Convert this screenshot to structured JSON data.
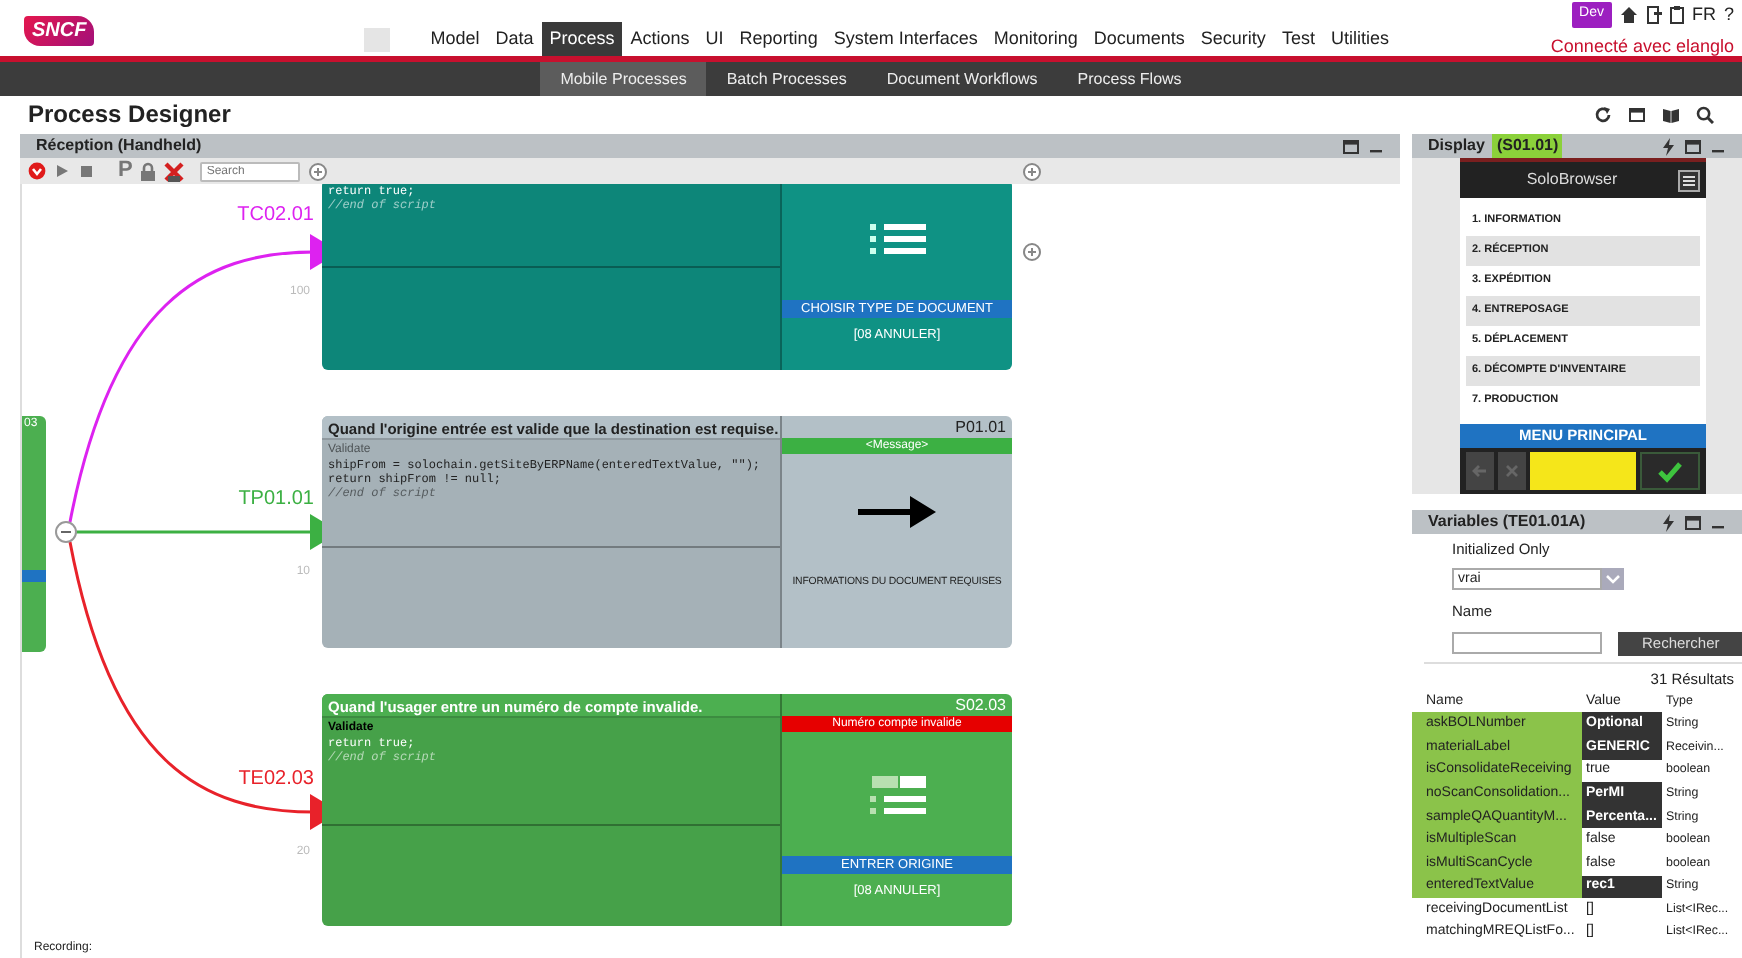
{
  "header": {
    "logo": "SNCF",
    "nav": [
      {
        "label": "Model",
        "selected": false
      },
      {
        "label": "Data",
        "selected": false
      },
      {
        "label": "Process",
        "selected": true
      },
      {
        "label": "Actions",
        "selected": false
      },
      {
        "label": "UI",
        "selected": false
      },
      {
        "label": "Reporting",
        "selected": false
      },
      {
        "label": "System Interfaces",
        "selected": false
      },
      {
        "label": "Monitoring",
        "selected": false
      },
      {
        "label": "Documents",
        "selected": false
      },
      {
        "label": "Security",
        "selected": false
      },
      {
        "label": "Test",
        "selected": false
      },
      {
        "label": "Utilities",
        "selected": false
      }
    ],
    "env_badge": "Dev",
    "language": "FR",
    "help": "?",
    "user": "Connecté avec elanglo"
  },
  "subnav": [
    {
      "label": "Mobile Processes",
      "selected": true
    },
    {
      "label": "Batch Processes",
      "selected": false
    },
    {
      "label": "Document Workflows",
      "selected": false
    },
    {
      "label": "Process Flows",
      "selected": false
    }
  ],
  "page_title": "Process Designer",
  "designer": {
    "title": "Réception (Handheld)",
    "toolbar_letter": "P",
    "search_placeholder": "Search",
    "source_node": {
      "label": "03",
      "color": "#4caf50"
    },
    "transitions": [
      {
        "label": "TC02.01",
        "color": "#dd22f0",
        "order": "100"
      },
      {
        "label": "TP01.01",
        "color": "#3cb043",
        "order": "10"
      },
      {
        "label": "TE02.03",
        "color": "#e8222a",
        "order": "20"
      }
    ],
    "cards": [
      {
        "color": "#0f9284",
        "code": [
          "return true;"
        ],
        "end_comment": "//end of script",
        "kind": "list",
        "action": "CHOISIR TYPE DE DOCUMENT",
        "cancel": "[08 ANNULER]"
      },
      {
        "color": "#b3c0c7",
        "title": "Quand l'origine entrée est valide que la destination est requise.",
        "code_label": "Validate",
        "code": [
          "shipFrom = solochain.getSiteByERPName(enteredTextValue, \"\");",
          "return shipFrom != null;"
        ],
        "end_comment": "//end of script",
        "node_id": "P01.01",
        "message": {
          "text": "<Message>",
          "color": "#3cb043"
        },
        "kind": "arrow",
        "description": "INFORMATIONS DU DOCUMENT REQUISES"
      },
      {
        "color": "#4caf50",
        "title": "Quand l'usager entre un numéro de compte invalide.",
        "code_label": "Validate",
        "code": [
          "return true;"
        ],
        "end_comment": "//end of script",
        "node_id": "S02.03",
        "message": {
          "text": "Numéro compte invalide",
          "color": "#e60000"
        },
        "kind": "form",
        "action": "ENTRER ORIGINE",
        "cancel": "[08 ANNULER]"
      }
    ],
    "status": "Recording:"
  },
  "display": {
    "title": "Display",
    "state_id": "(S01.01)",
    "app_title": "SoloBrowser",
    "menu": [
      "1. INFORMATION",
      "2. RÉCEPTION",
      "3. EXPÉDITION",
      "4. ENTREPOSAGE",
      "5. DÉPLACEMENT",
      "6. DÉCOMPTE D'INVENTAIRE",
      "7. PRODUCTION"
    ],
    "footer": "MENU PRINCIPAL"
  },
  "variables": {
    "title": "Variables (TE01.01A)",
    "filter_label": "Initialized Only",
    "filter_value": "vrai",
    "name_label": "Name",
    "search_button": "Rechercher",
    "results": "31 Résultats",
    "columns": [
      "Name",
      "Value",
      "Type"
    ],
    "rows": [
      {
        "name": "askBOLNumber",
        "value": "Optional",
        "type": "String",
        "initialized": true,
        "overridden": true
      },
      {
        "name": "materialLabel",
        "value": "GENERIC",
        "type": "Receivin...",
        "initialized": true,
        "overridden": true
      },
      {
        "name": "isConsolidateReceiving",
        "value": "true",
        "type": "boolean",
        "initialized": true,
        "overridden": false
      },
      {
        "name": "noScanConsolidation...",
        "value": "PerMI",
        "type": "String",
        "initialized": true,
        "overridden": true
      },
      {
        "name": "sampleQAQuantityM...",
        "value": "Percenta...",
        "type": "String",
        "initialized": true,
        "overridden": true
      },
      {
        "name": "isMultipleScan",
        "value": "false",
        "type": "boolean",
        "initialized": true,
        "overridden": false
      },
      {
        "name": "isMultiScanCycle",
        "value": "false",
        "type": "boolean",
        "initialized": true,
        "overridden": false
      },
      {
        "name": "enteredTextValue",
        "value": "rec1",
        "type": "String",
        "initialized": true,
        "overridden": true
      },
      {
        "name": "receivingDocumentList",
        "value": "[]",
        "type": "List<IRec...",
        "initialized": false,
        "overridden": false
      },
      {
        "name": "matchingMREQListFo...",
        "value": "[]",
        "type": "List<IRec...",
        "initialized": false,
        "overridden": false
      }
    ]
  }
}
